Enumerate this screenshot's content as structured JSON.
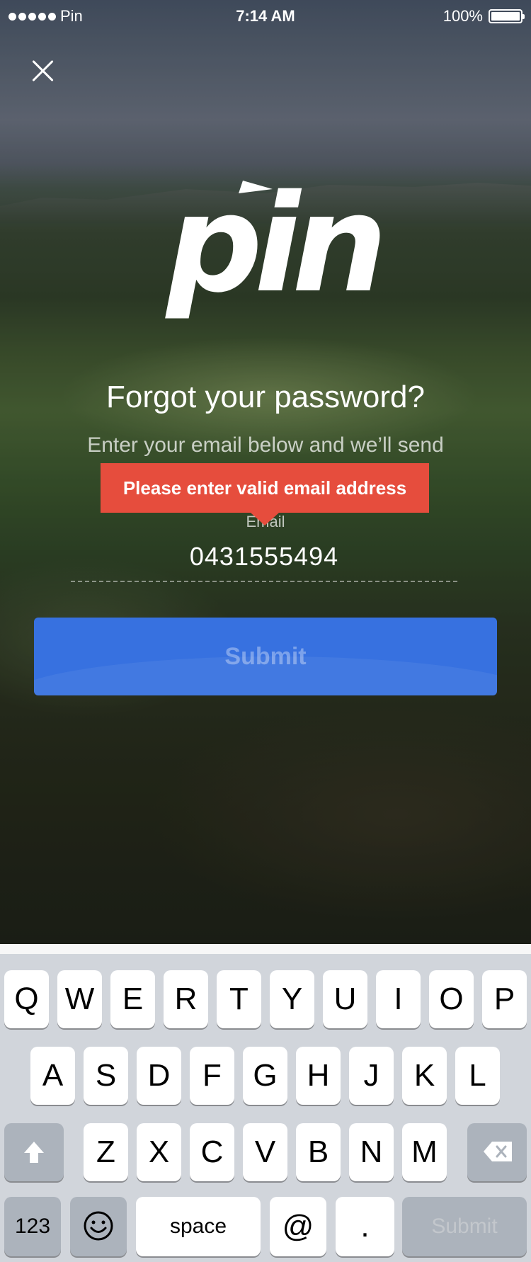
{
  "status_bar": {
    "carrier": "Pin",
    "time": "7:14 AM",
    "battery": "100%"
  },
  "logo_text": "pin",
  "title": "Forgot your password?",
  "subtitle": "Enter your email below and we’ll send",
  "error_tooltip": "Please enter valid email address",
  "email_field": {
    "label": "Email",
    "value": "0431555494"
  },
  "submit_label": "Submit",
  "keyboard": {
    "row1": [
      "Q",
      "W",
      "E",
      "R",
      "T",
      "Y",
      "U",
      "I",
      "O",
      "P"
    ],
    "row2": [
      "A",
      "S",
      "D",
      "F",
      "G",
      "H",
      "J",
      "K",
      "L"
    ],
    "row3": [
      "Z",
      "X",
      "C",
      "V",
      "B",
      "N",
      "M"
    ],
    "numbers_key": "123",
    "emoji_key": "😊",
    "space_key": "space",
    "at_key": "@",
    "period_key": ".",
    "submit_key": "Submit"
  }
}
